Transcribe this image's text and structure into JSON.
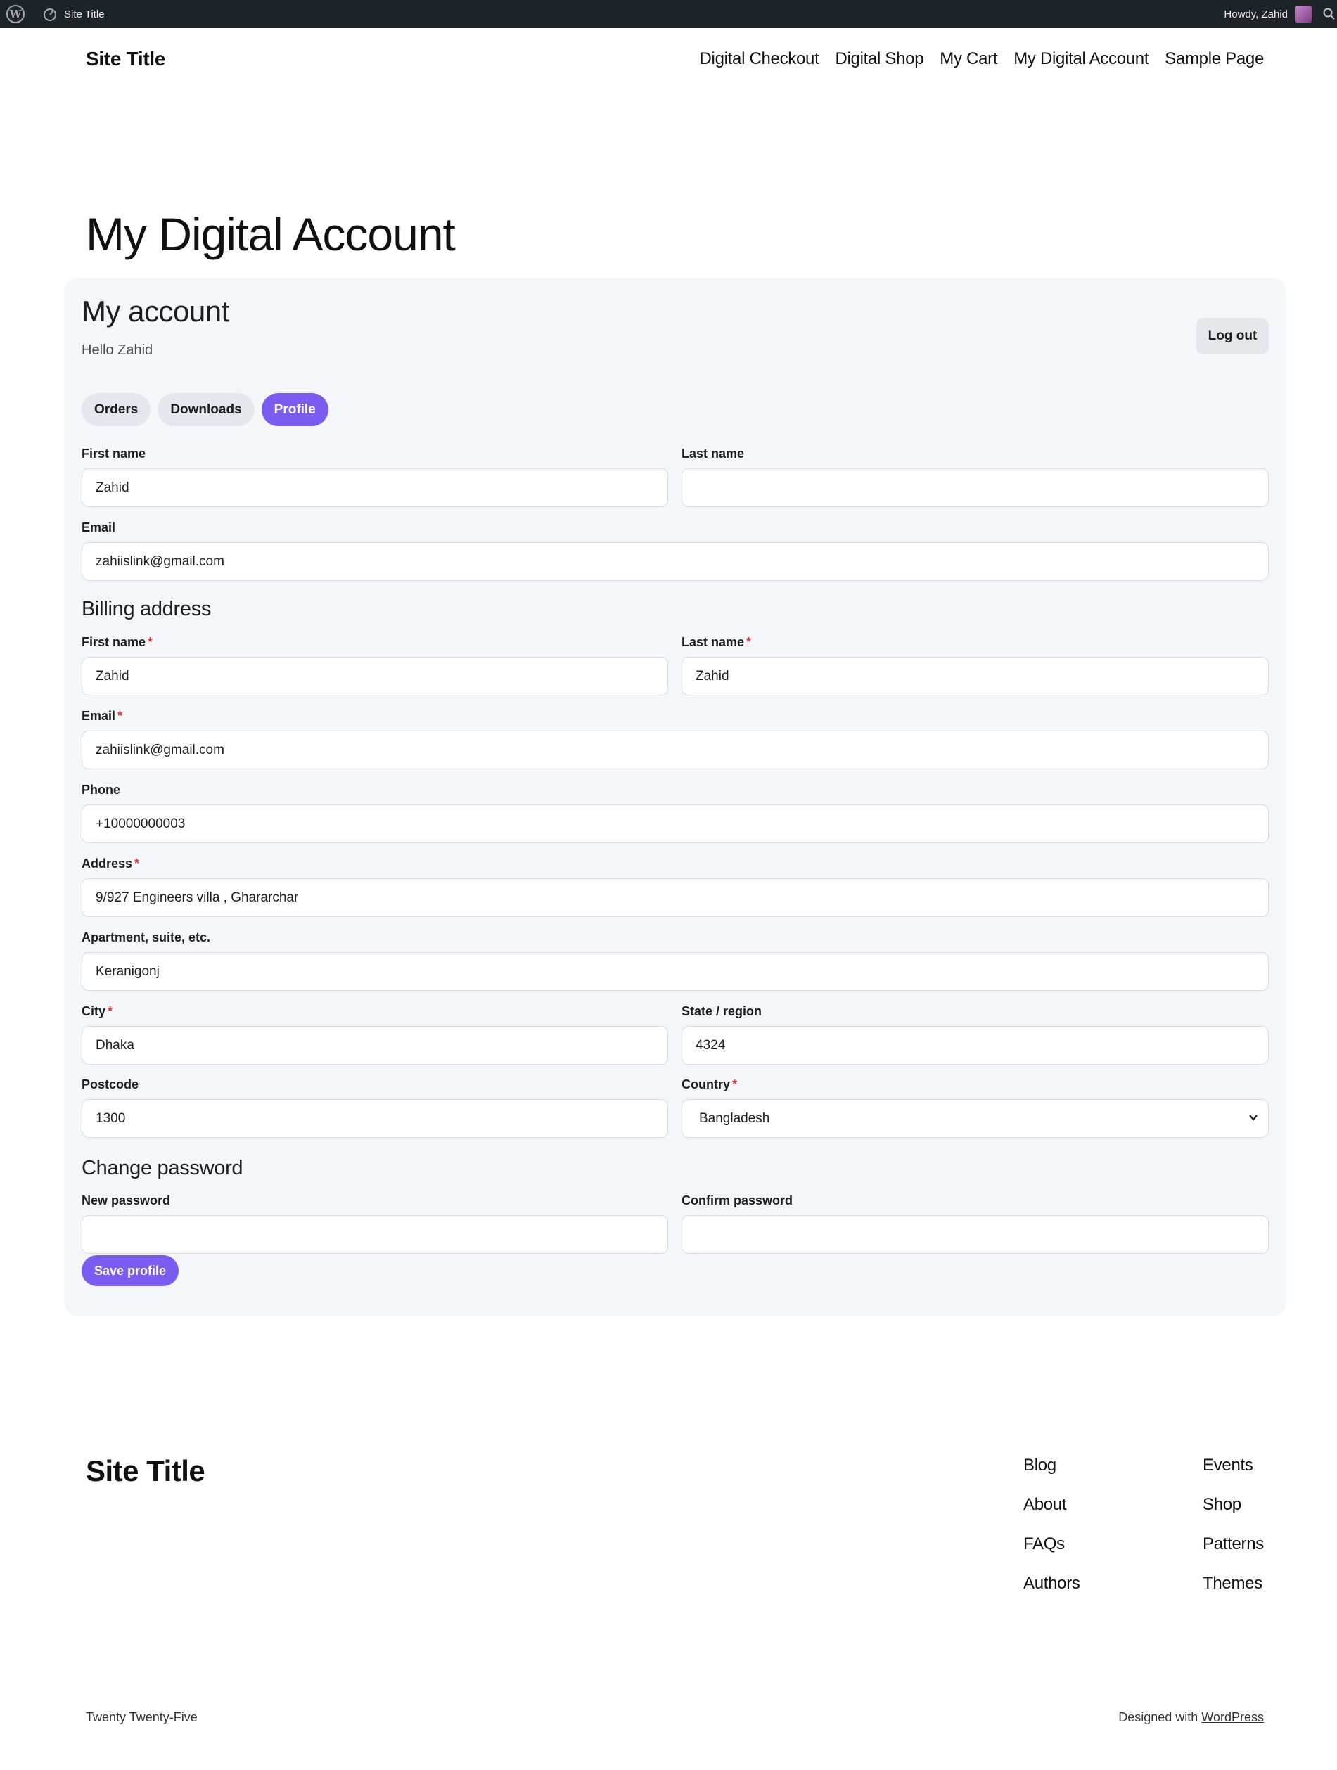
{
  "admin_bar": {
    "site_title": "Site Title",
    "howdy": "Howdy, Zahid"
  },
  "header": {
    "site_title": "Site Title",
    "nav": [
      "Digital Checkout",
      "Digital Shop",
      "My Cart",
      "My Digital Account",
      "Sample Page"
    ]
  },
  "page_title": "My Digital Account",
  "account": {
    "heading": "My account",
    "hello": "Hello Zahid",
    "logout_label": "Log out",
    "tabs": [
      "Orders",
      "Downloads",
      "Profile"
    ],
    "active_tab": "Profile",
    "profile": {
      "first_name_label": "First name",
      "first_name": "Zahid",
      "last_name_label": "Last name",
      "last_name": "",
      "email_label": "Email",
      "email": "zahiislink@gmail.com"
    },
    "billing": {
      "heading": "Billing address",
      "first_name_label": "First name",
      "first_name": "Zahid",
      "last_name_label": "Last name",
      "last_name": "Zahid",
      "email_label": "Email",
      "email": "zahiislink@gmail.com",
      "phone_label": "Phone",
      "phone": "+10000000003",
      "address_label": "Address",
      "address": "9/927 Engineers villa , Ghararchar",
      "apartment_label": "Apartment, suite, etc.",
      "apartment": "Keranigonj",
      "city_label": "City",
      "city": "Dhaka",
      "state_label": "State / region",
      "state": "4324",
      "postcode_label": "Postcode",
      "postcode": "1300",
      "country_label": "Country",
      "country": "Bangladesh",
      "required_mark": "*"
    },
    "password": {
      "heading": "Change password",
      "new_label": "New password",
      "new_value": "",
      "confirm_label": "Confirm password",
      "confirm_value": ""
    },
    "save_label": "Save profile"
  },
  "footer": {
    "site_title": "Site Title",
    "col1": [
      "Blog",
      "About",
      "FAQs",
      "Authors"
    ],
    "col2": [
      "Events",
      "Shop",
      "Patterns",
      "Themes"
    ],
    "theme_name": "Twenty Twenty-Five",
    "designed_with": "Designed with",
    "wordpress_link": "WordPress"
  },
  "colors": {
    "accent": "#7b5cf0",
    "card_bg": "#f5f6fa",
    "admin_bar_bg": "#1d2327",
    "required": "#d63638"
  },
  "icons": {
    "admin_logo": "wordpress-logo-icon",
    "site_dashboard": "gauge-icon",
    "avatar": "user-avatar",
    "search": "search-icon",
    "select_chevron": "chevron-down-icon"
  }
}
